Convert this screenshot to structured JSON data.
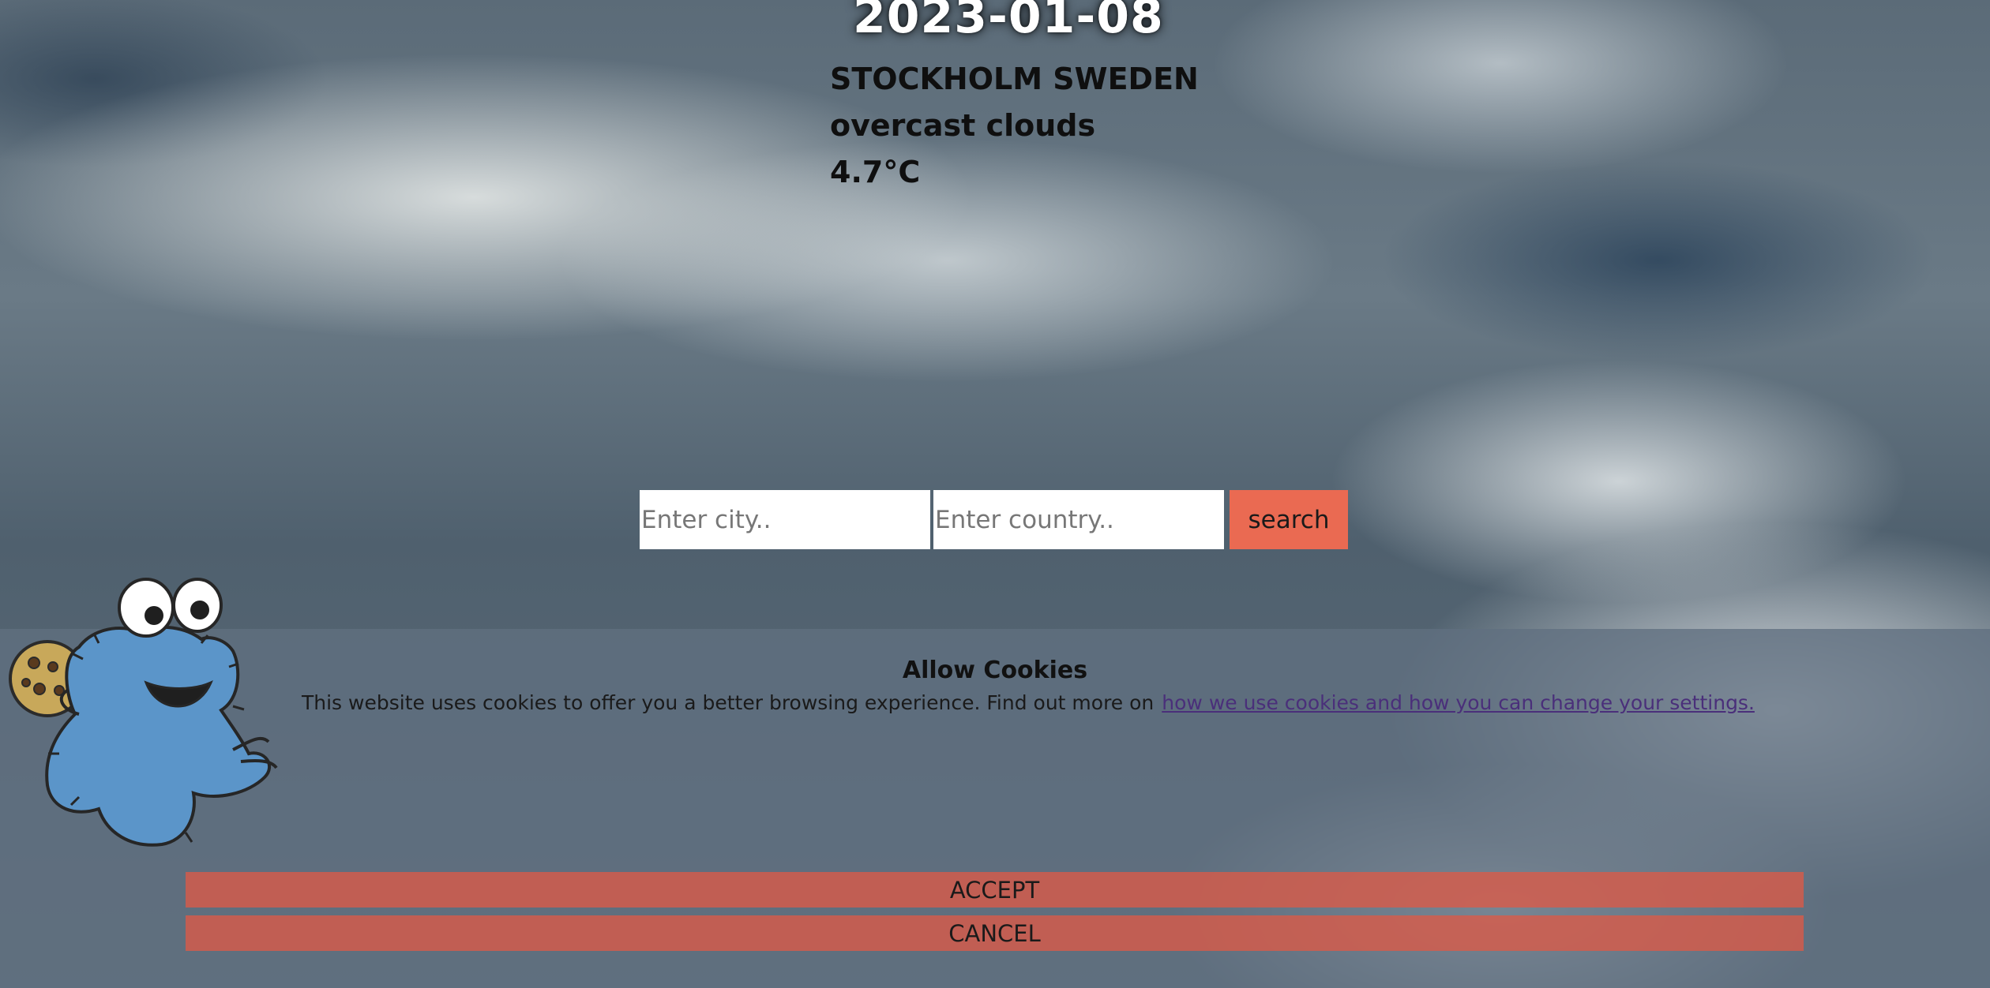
{
  "weather": {
    "date": "2023-01-08",
    "location": "STOCKHOLM SWEDEN",
    "description": "overcast clouds",
    "temperature": "4.7°C"
  },
  "search": {
    "city_placeholder": "Enter city..",
    "country_placeholder": "Enter country..",
    "button_label": "search"
  },
  "cookie_banner": {
    "title": "Allow Cookies",
    "text": "This website uses cookies to offer you a better browsing experience. Find out more on",
    "link_text": "how we use cookies and how you can change your settings.",
    "accept_label": "ACCEPT",
    "cancel_label": "CANCEL",
    "mascot_icon": "cookie-monster-icon"
  },
  "colors": {
    "accent": "#ea6a52",
    "link": "#4a2f7a"
  }
}
